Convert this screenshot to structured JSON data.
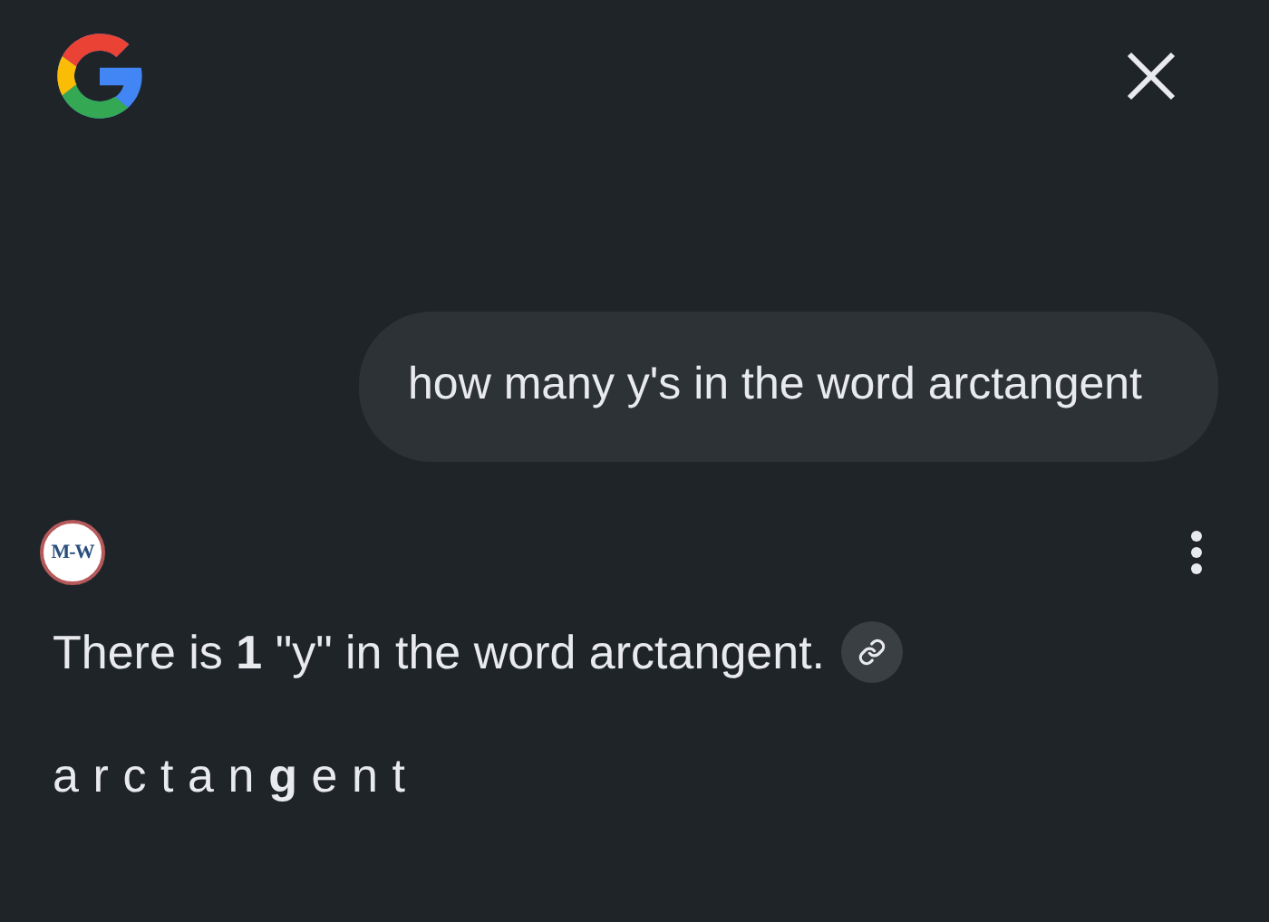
{
  "query": "how many y's in the word arctangent",
  "source": {
    "badge": "M-W"
  },
  "answer": {
    "text": "There is **1** \"y\" in the word arctangent.",
    "spelled": "arctan**g**ent"
  }
}
